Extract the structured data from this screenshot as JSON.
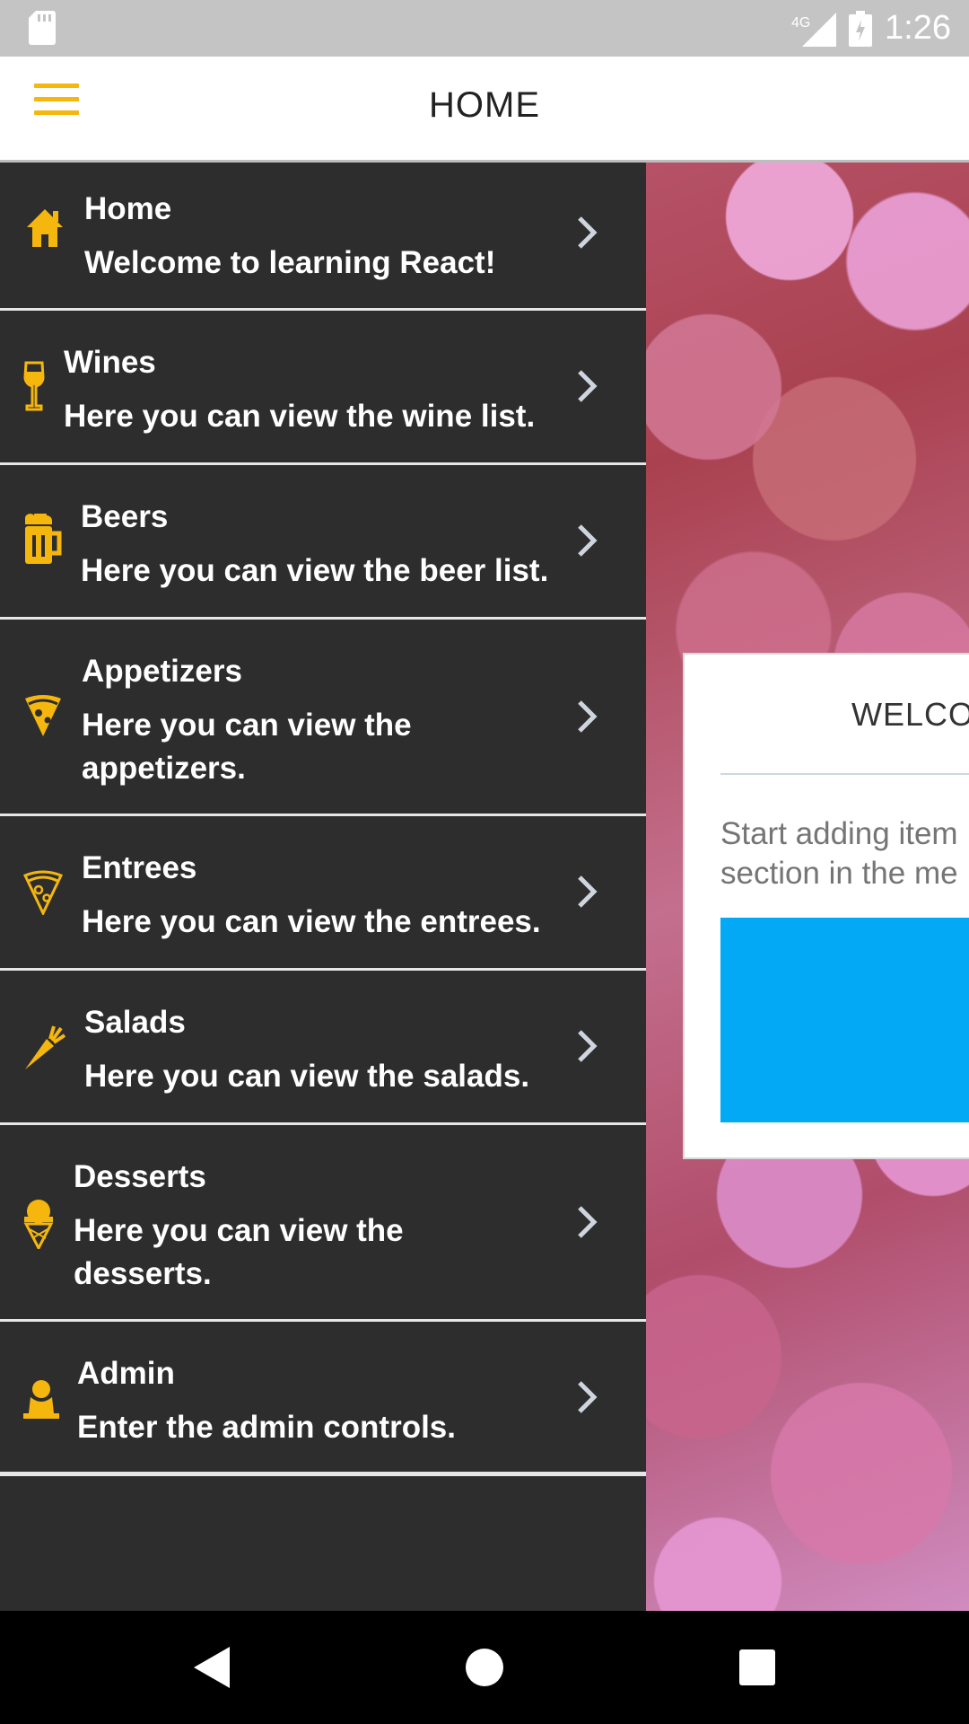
{
  "status_bar": {
    "time": "1:26",
    "network": "4G"
  },
  "header": {
    "title": "HOME"
  },
  "menu": {
    "items": [
      {
        "title": "Home",
        "description": "Welcome to learning React!",
        "icon": "home-icon"
      },
      {
        "title": "Wines",
        "description": "Here you can view the wine list.",
        "icon": "wine-glass-icon"
      },
      {
        "title": "Beers",
        "description": "Here you can view the beer list.",
        "icon": "beer-mug-icon"
      },
      {
        "title": "Appetizers",
        "description": "Here you can view the appetizers.",
        "icon": "pizza-slice-icon"
      },
      {
        "title": "Entrees",
        "description": "Here you can view the entrees.",
        "icon": "pizza-slice-outline-icon"
      },
      {
        "title": "Salads",
        "description": "Here you can view the salads.",
        "icon": "carrot-icon"
      },
      {
        "title": "Desserts",
        "description": "Here you can view the desserts.",
        "icon": "ice-cream-icon"
      },
      {
        "title": "Admin",
        "description": "Enter the admin controls.",
        "icon": "user-icon"
      }
    ]
  },
  "welcome_card": {
    "title": "WELCOM",
    "body": "Start adding item\nsection in the me"
  },
  "colors": {
    "accent": "#f5b70d",
    "drawer_bg": "#2d2d2d",
    "button_blue": "#03a9f4"
  }
}
